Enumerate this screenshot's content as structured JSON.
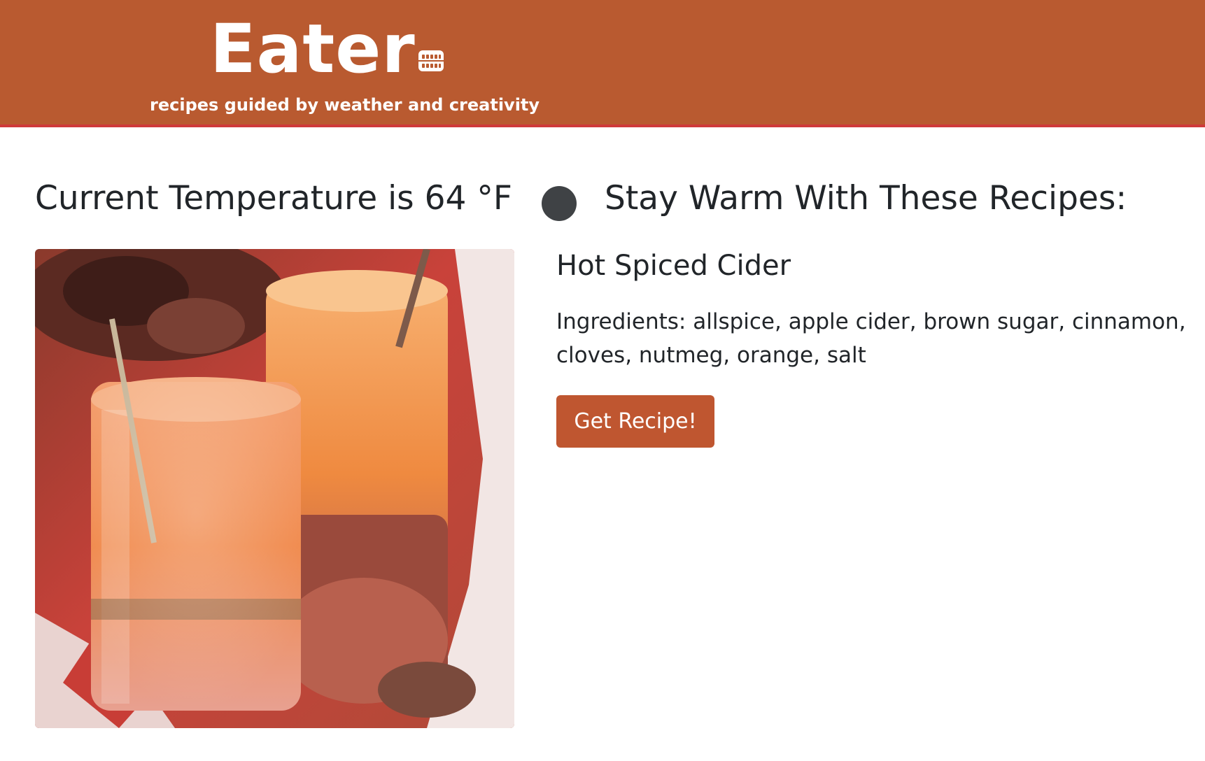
{
  "header": {
    "brand": "Eater",
    "tagline": "recipes guided by weather and creativity",
    "brand_icon": "pot-icon",
    "background_color": "#b95a30",
    "border_color": "#cf3a3a"
  },
  "weather": {
    "temperature_text": "Current Temperature is 64 °F",
    "indicator_icon": "status-dot-icon",
    "indicator_color": "#3f4245",
    "message": "Stay Warm With These Recipes:"
  },
  "recipe": {
    "title": "Hot Spiced Cider",
    "ingredients_text": "Ingredients: allspice, apple cider, brown sugar, cinnamon, cloves, nutmeg, orange, salt",
    "button_label": "Get Recipe!",
    "button_color": "#bf5630",
    "image_alt": "photo"
  }
}
